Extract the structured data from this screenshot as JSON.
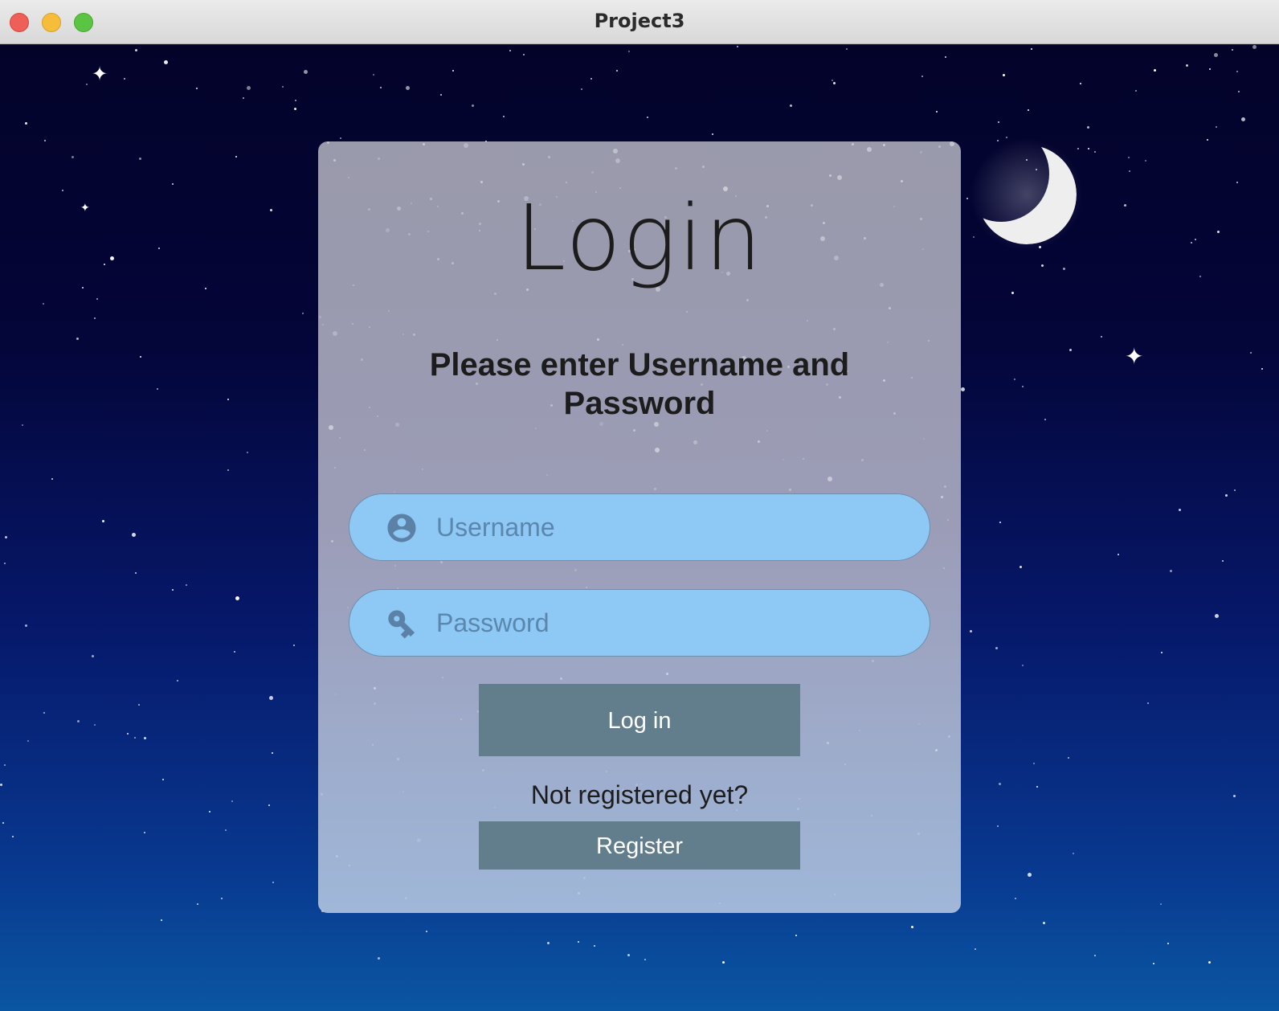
{
  "window": {
    "title": "Project3"
  },
  "login": {
    "heading": "Login",
    "subtitle": "Please enter Username and Password",
    "username": {
      "placeholder": "Username",
      "value": "",
      "icon": "account-circle-icon"
    },
    "password": {
      "placeholder": "Password",
      "value": "",
      "icon": "key-icon"
    },
    "login_button": "Log in",
    "not_registered_text": "Not registered yet?",
    "register_button": "Register"
  },
  "colors": {
    "field_fill": "#8ec9f6",
    "button_fill": "#627e8c",
    "sky_top": "#03032a",
    "sky_bottom": "#0a56a3"
  }
}
